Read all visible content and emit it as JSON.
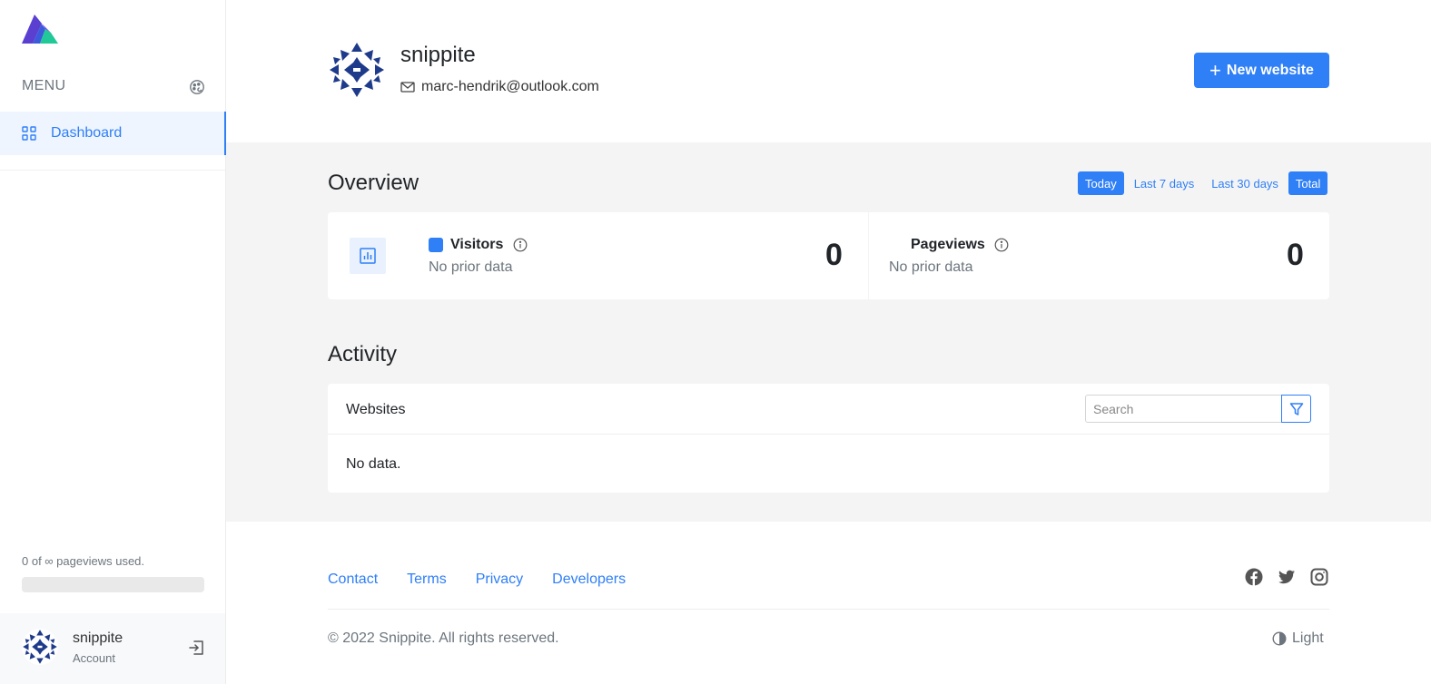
{
  "sidebar": {
    "menu_label": "MENU",
    "nav": {
      "dashboard_label": "Dashboard"
    },
    "usage": {
      "text": "0 of ∞ pageviews used.",
      "fraction": 0
    },
    "account": {
      "name": "snippite",
      "subtitle": "Account"
    }
  },
  "header": {
    "username": "snippite",
    "email": "marc-hendrik@outlook.com",
    "new_website_label": "New website"
  },
  "overview": {
    "title": "Overview",
    "tabs": [
      {
        "label": "Today",
        "active": true
      },
      {
        "label": "Last 7 days",
        "active": false
      },
      {
        "label": "Last 30 days",
        "active": false
      },
      {
        "label": "Total",
        "active": true
      }
    ],
    "stats": [
      {
        "label": "Visitors",
        "sub": "No prior data",
        "value": "0"
      },
      {
        "label": "Pageviews",
        "sub": "No prior data",
        "value": "0"
      }
    ]
  },
  "activity": {
    "title": "Activity",
    "card_title": "Websites",
    "search_placeholder": "Search",
    "empty_text": "No data."
  },
  "footer": {
    "links": [
      "Contact",
      "Terms",
      "Privacy",
      "Developers"
    ],
    "copyright": "© 2022 Snippite. All rights reserved.",
    "theme_label": "Light"
  },
  "colors": {
    "accent": "#2f7ff7",
    "avatar": "#1e3a8a"
  }
}
